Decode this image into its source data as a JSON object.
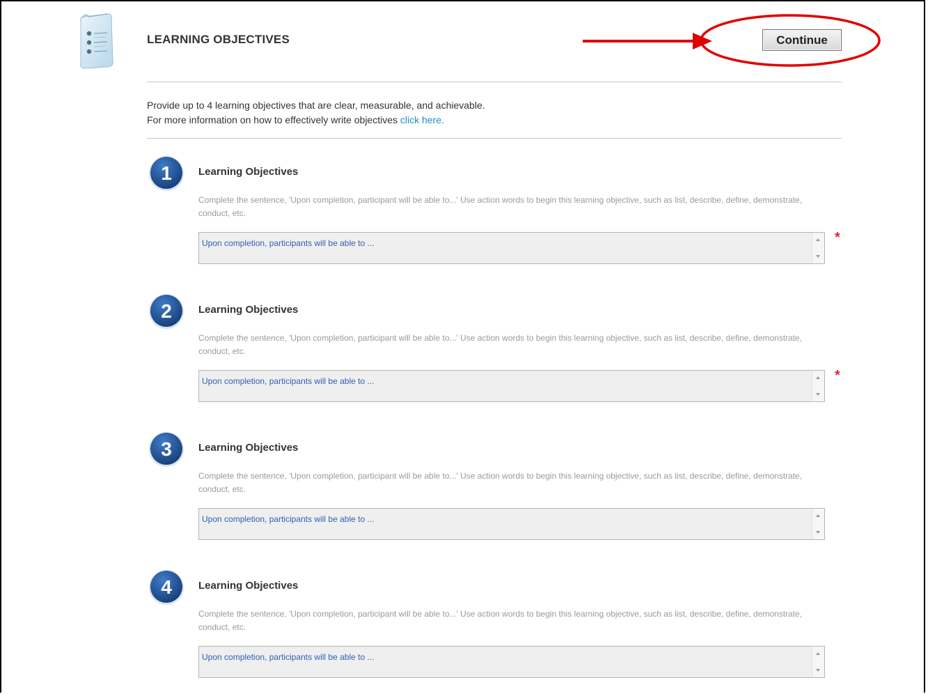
{
  "header": {
    "title": "LEARNING OBJECTIVES",
    "icon": "scroll-list-icon",
    "continue_label": "Continue"
  },
  "annotation": {
    "arrow": "red-arrow-icon",
    "highlight": "red-ellipse-highlight",
    "color": "#e00000"
  },
  "intro": {
    "line1": "Provide up to 4 learning objectives that are clear, measurable, and achievable.",
    "line2_prefix": "For more information on how to effectively write objectives ",
    "link_label": "click here."
  },
  "objectives": [
    {
      "number": "1",
      "title": "Learning Objectives",
      "help": "Complete the sentence, 'Upon completion, participant will be able to...' Use action words to begin this learning objective, such as list, describe, define, demonstrate, conduct, etc.",
      "value": "Upon completion, participants will be able to ...",
      "required": "*"
    },
    {
      "number": "2",
      "title": "Learning Objectives",
      "help": "Complete the sentence, 'Upon completion, participant will be able to...' Use action words to begin this learning objective, such as list, describe, define, demonstrate, conduct, etc.",
      "value": "Upon completion, participants will be able to ...",
      "required": "*"
    },
    {
      "number": "3",
      "title": "Learning Objectives",
      "help": "Complete the sentence, 'Upon completion, participant will be able to...' Use action words to begin this learning objective, such as list, describe, define, demonstrate, conduct, etc.",
      "value": "Upon completion, participants will be able to ..."
    },
    {
      "number": "4",
      "title": "Learning Objectives",
      "help": "Complete the sentence, 'Upon completion, participant will be able to...' Use action words to begin this learning objective, such as list, describe, define, demonstrate, conduct, etc.",
      "value": "Upon completion, participants will be able to ..."
    }
  ],
  "colors": {
    "badge": "#1d4f9c",
    "link": "#1a8fc9",
    "required": "#e0263a",
    "input_text": "#2f5fb3"
  }
}
